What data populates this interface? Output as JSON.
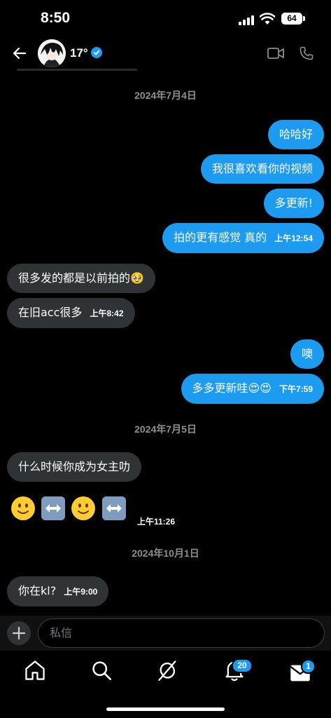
{
  "status_bar": {
    "time": "8:50",
    "battery": "64"
  },
  "header": {
    "name": "17°"
  },
  "messages": [
    {
      "type": "date",
      "text": "2024年7月4日"
    },
    {
      "type": "out",
      "text": "哈哈好"
    },
    {
      "type": "out",
      "text": "我很喜欢看你的视频"
    },
    {
      "type": "out",
      "text": "多更新!"
    },
    {
      "type": "out",
      "text": "拍的更有感觉 真的",
      "time": "上午12:54"
    },
    {
      "type": "in",
      "text": "很多发的都是以前拍的🥹"
    },
    {
      "type": "in",
      "text": "在旧acc很多",
      "time": "上午8:42"
    },
    {
      "type": "out",
      "text": "噢"
    },
    {
      "type": "out",
      "text": "多多更新哇😍😍",
      "time": "下午7:59"
    },
    {
      "type": "date",
      "text": "2024年7月5日"
    },
    {
      "type": "in",
      "text": "什么时候你成为女主叻"
    },
    {
      "type": "in-emoji",
      "text": "🙂↔️🙂↔️",
      "time": "上午11:26"
    },
    {
      "type": "date",
      "text": "2024年10月1日"
    },
    {
      "type": "in",
      "text": "你在kl?",
      "time": "上午9:00"
    }
  ],
  "composer": {
    "placeholder": "私信"
  },
  "nav": {
    "items": [
      "home-icon",
      "search-icon",
      "grok-icon",
      "notifications-icon",
      "messages-icon"
    ],
    "notifications_badge": "20",
    "messages_badge": "1"
  },
  "colors": {
    "accent": "#1d9bf0",
    "incoming_bubble": "#2f3336",
    "background": "#000000"
  }
}
